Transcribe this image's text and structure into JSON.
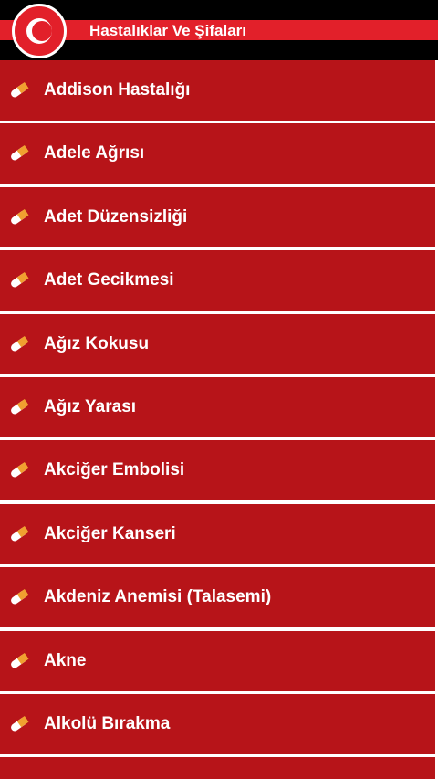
{
  "app": {
    "title": "Hastalıklar Ve Şifaları",
    "logo_icon": "crescent-logo-icon",
    "colors": {
      "header": "#000000",
      "accent": "#e2202a",
      "row": "#b71419",
      "text": "#ffffff"
    }
  },
  "list": {
    "item_icon": "pill-capsule-icon",
    "items": [
      {
        "label": "Addison Hastalığı"
      },
      {
        "label": "Adele Ağrısı"
      },
      {
        "label": "Adet Düzensizliği"
      },
      {
        "label": "Adet Gecikmesi"
      },
      {
        "label": "Ağız Kokusu"
      },
      {
        "label": "Ağız Yarası"
      },
      {
        "label": "Akciğer Embolisi"
      },
      {
        "label": "Akciğer Kanseri"
      },
      {
        "label": "Akdeniz Anemisi (Talasemi)"
      },
      {
        "label": "Akne"
      },
      {
        "label": "Alkolü Bırakma"
      }
    ]
  }
}
